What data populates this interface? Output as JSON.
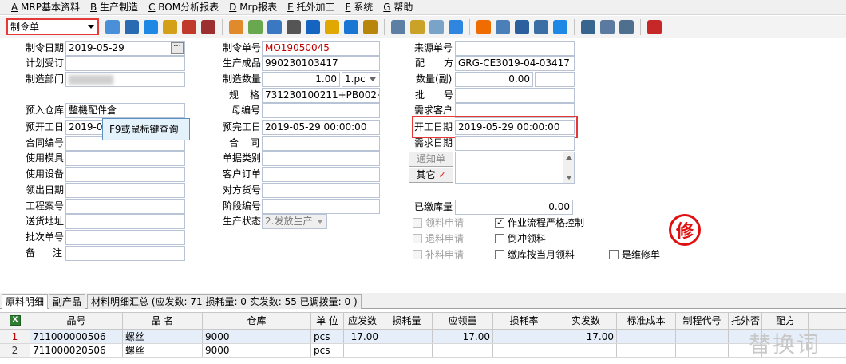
{
  "menu": [
    {
      "key": "A",
      "label": "MRP基本资料"
    },
    {
      "key": "B",
      "label": "生产制造"
    },
    {
      "key": "C",
      "label": "BOM分析报表"
    },
    {
      "key": "D",
      "label": "Mrp报表"
    },
    {
      "key": "E",
      "label": "托外加工"
    },
    {
      "key": "F",
      "label": "系统"
    },
    {
      "key": "G",
      "label": "帮助"
    }
  ],
  "toolbar": {
    "doc_type": "制令单",
    "icons": [
      "copy-icon",
      "save-icon",
      "phone-icon",
      "lock-icon",
      "briefcase-icon",
      "print-icon",
      "users-icon",
      "mail-icon",
      "upload-icon",
      "arrow-icon",
      "help-icon",
      "download-icon",
      "cart-icon",
      "money-icon",
      "refresh-icon",
      "folder-icon",
      "docs-icon",
      "check-icon",
      "bell-icon",
      "search-icon",
      "tree-icon",
      "monitor-icon",
      "sync-icon",
      "window-icon",
      "close-window-icon",
      "restore-icon",
      "exit-icon"
    ]
  },
  "form": {
    "labels": {
      "order_date": "制令日期",
      "plan_dept": "计划受订",
      "mfg_dept": "制造部门",
      "warehouse": "预入仓库",
      "plan_start": "预开工日",
      "contract": "合同编号",
      "mold": "使用模具",
      "equipment": "使用设备",
      "pick_date": "领出日期",
      "project": "工程案号",
      "ship_addr": "送货地址",
      "batch": "批次单号",
      "remark": "备",
      "remark2": "注",
      "order_no": "制令单号",
      "product": "生产成品",
      "qty": "制造数量",
      "spec1": "规",
      "spec2": "格",
      "parent_no": "母编号",
      "plan_finish": "预完工日",
      "contract2_1": "合",
      "contract2_2": "同",
      "doc_type": "单据类别",
      "cust_order": "客户订单",
      "cust_part": "对方货号",
      "stage": "阶段编号",
      "prod_status": "生产状态",
      "source_no": "来源单号",
      "formula1": "配",
      "formula2": "方",
      "qty_sub": "数量(副)",
      "batch_no1": "批",
      "batch_no2": "号",
      "demand_cust": "需求客户",
      "start_date": "开工日期",
      "demand_date": "需求日期",
      "stocked_qty": "已缴库量"
    },
    "values": {
      "order_date": "2019-05-29",
      "mfg_dept": "",
      "warehouse": "整機配件倉",
      "plan_start": "2019-05",
      "order_no": "MO19050045",
      "product": "990230103417",
      "qty": "1.00",
      "qty_unit": "1.pc",
      "spec": "731230100211+PB002+G",
      "plan_finish": "2019-05-29 00:00:00",
      "prod_status": "2.发放生产",
      "formula": "GRG-CE3019-04-03417",
      "qty_sub": "0.00",
      "start_date": "2019-05-29 00:00:00",
      "stocked_qty": "0.00"
    },
    "tooltip": "F9或鼠标键查询",
    "buttons": {
      "notice": "通知单",
      "other": "其它"
    },
    "checkboxes": [
      {
        "label": "领料申请",
        "checked": false,
        "disabled": true
      },
      {
        "label": "作业流程严格控制",
        "checked": true,
        "disabled": false
      },
      {
        "label": "退料申请",
        "checked": false,
        "disabled": true
      },
      {
        "label": "倒冲领料",
        "checked": false,
        "disabled": false
      },
      {
        "label": "补料申请",
        "checked": false,
        "disabled": true
      },
      {
        "label": "缴库按当月领料",
        "checked": false,
        "disabled": false
      },
      {
        "label": "是维修单",
        "checked": false,
        "disabled": false
      }
    ],
    "seal": "修"
  },
  "tabs": [
    {
      "label": "原料明细"
    },
    {
      "label": "副产品"
    },
    {
      "label": "材料明细汇总 (应发数: 71 损耗量: 0 实发数: 55 已调拨量: 0 )"
    }
  ],
  "grid": {
    "columns": [
      "品号",
      "品 名",
      "仓库",
      "单 位",
      "应发数",
      "损耗量",
      "应领量",
      "损耗率",
      "实发数",
      "标准成本",
      "制程代号",
      "托外否",
      "配方"
    ],
    "rows": [
      {
        "num": "1",
        "cells": [
          "711000000506",
          "螺丝",
          "9000",
          "pcs",
          "17.00",
          "",
          "17.00",
          "",
          "17.00",
          "",
          "",
          "",
          ""
        ]
      },
      {
        "num": "2",
        "cells": [
          "711000020506",
          "螺丝",
          "9000",
          "pcs",
          "",
          "",
          "",
          "",
          "",
          "",
          "",
          "",
          ""
        ]
      }
    ]
  },
  "watermark": "替换词"
}
